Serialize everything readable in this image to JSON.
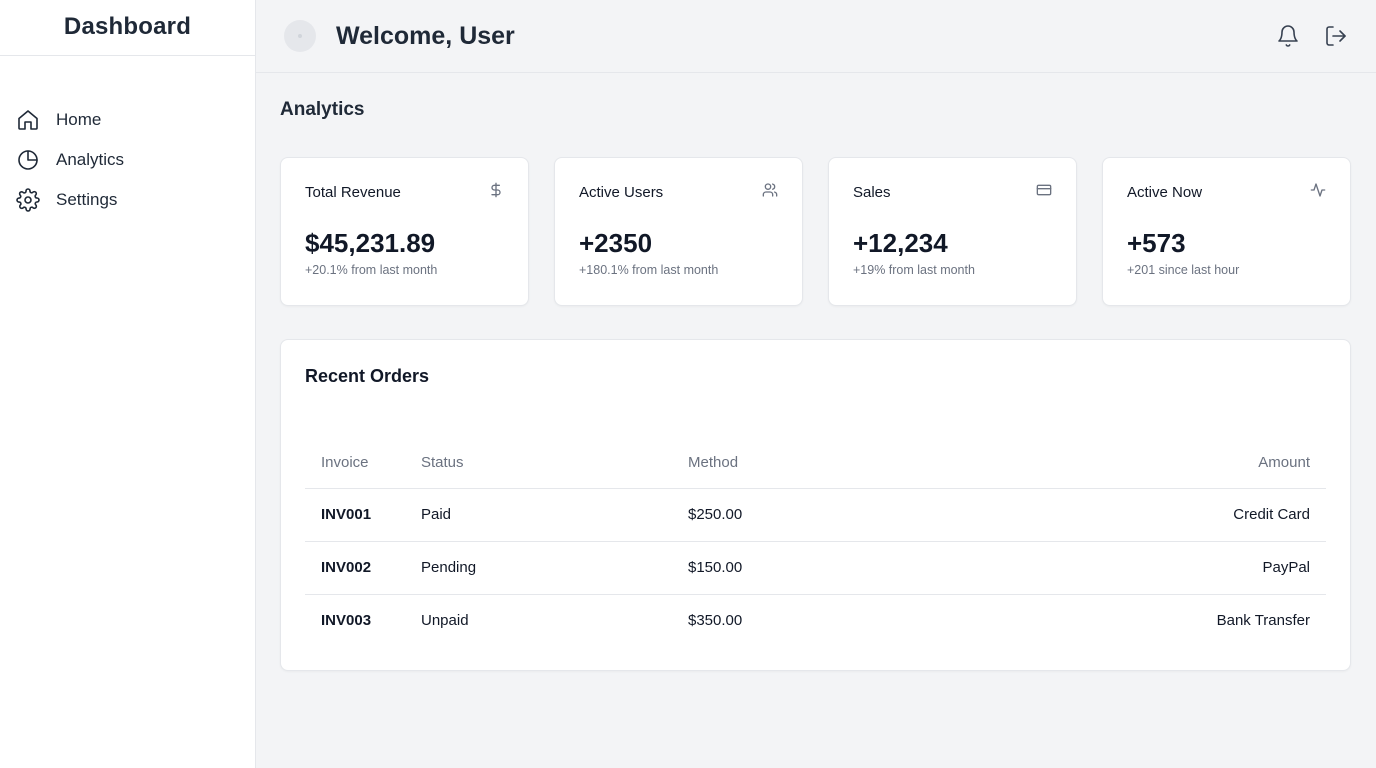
{
  "sidebar": {
    "brand": "Dashboard",
    "items": [
      {
        "label": "Home",
        "icon": "home-icon"
      },
      {
        "label": "Analytics",
        "icon": "pie-chart-icon"
      },
      {
        "label": "Settings",
        "icon": "gear-icon"
      }
    ]
  },
  "header": {
    "welcome": "Welcome, User",
    "icons": [
      "bell-icon",
      "logout-icon"
    ]
  },
  "main": {
    "section_title": "Analytics",
    "cards": [
      {
        "title": "Total Revenue",
        "value": "$45,231.89",
        "sub": "+20.1% from last month",
        "icon": "dollar-icon"
      },
      {
        "title": "Active Users",
        "value": "+2350",
        "sub": "+180.1% from last month",
        "icon": "users-icon"
      },
      {
        "title": "Sales",
        "value": "+12,234",
        "sub": "+19% from last month",
        "icon": "credit-card-icon"
      },
      {
        "title": "Active Now",
        "value": "+573",
        "sub": "+201 since last hour",
        "icon": "activity-icon"
      }
    ],
    "orders": {
      "title": "Recent Orders",
      "columns": [
        "Invoice",
        "Status",
        "Method",
        "Amount"
      ],
      "rows": [
        [
          "INV001",
          "Paid",
          "$250.00",
          "Credit Card"
        ],
        [
          "INV002",
          "Pending",
          "$150.00",
          "PayPal"
        ],
        [
          "INV003",
          "Unpaid",
          "$350.00",
          "Bank Transfer"
        ]
      ]
    }
  },
  "colors": {
    "background": "#f3f4f6",
    "surface": "#ffffff",
    "border": "#e5e7eb",
    "text": "#111827",
    "muted": "#6b7280"
  }
}
